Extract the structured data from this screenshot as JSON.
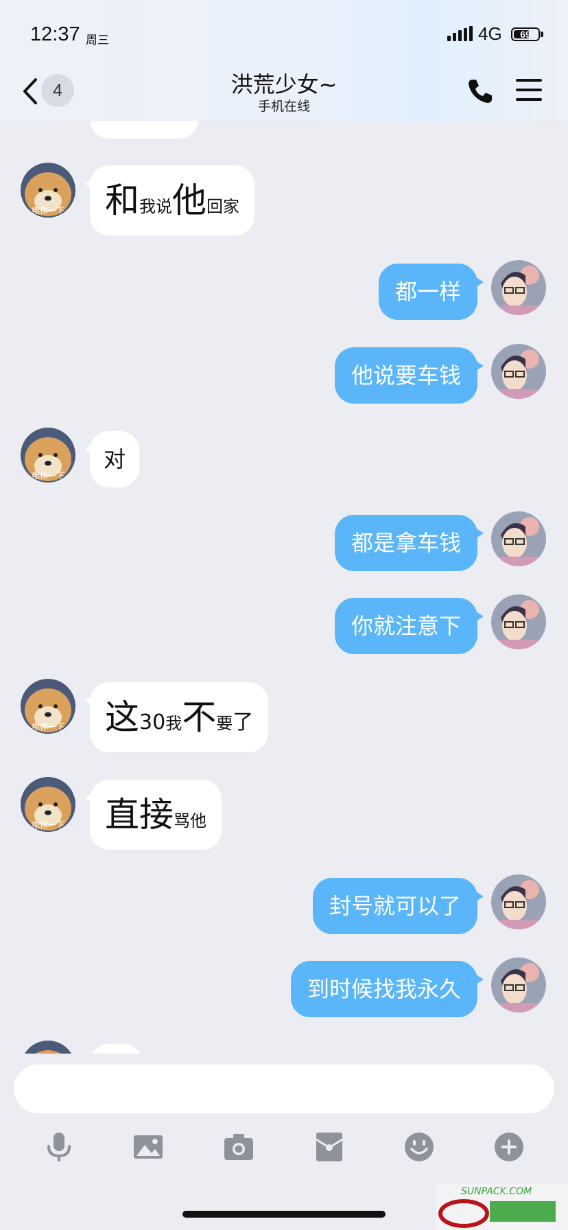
{
  "status_bar": {
    "time": "12:37",
    "day": "周三",
    "network": "4G",
    "battery": "69",
    "battery_level": 0.69
  },
  "header": {
    "back_count": "4",
    "title": "洪荒少女~",
    "subtitle": "手机在线"
  },
  "messages": [
    {
      "side": "left",
      "segments": [
        {
          "t": "和",
          "s": "big"
        },
        {
          "t": "我说",
          "s": "small"
        },
        {
          "t": "他",
          "s": "big"
        },
        {
          "t": "回家",
          "s": "small"
        }
      ]
    },
    {
      "side": "right",
      "text": "都一样"
    },
    {
      "side": "right",
      "text": "他说要车钱"
    },
    {
      "side": "left",
      "text": "对"
    },
    {
      "side": "right",
      "text": "都是拿车钱"
    },
    {
      "side": "right",
      "text": "你就注意下"
    },
    {
      "side": "left",
      "segments": [
        {
          "t": "这",
          "s": "big"
        },
        {
          "t": "30",
          "s": "mid"
        },
        {
          "t": "我",
          "s": "small"
        },
        {
          "t": "不",
          "s": "big"
        },
        {
          "t": "要",
          "s": "small"
        },
        {
          "t": "了",
          "s": "mid"
        }
      ]
    },
    {
      "side": "left",
      "segments": [
        {
          "t": "直接",
          "s": "big"
        },
        {
          "t": "骂他",
          "s": "small"
        }
      ]
    },
    {
      "side": "right",
      "text": "封号就可以了"
    },
    {
      "side": "right",
      "text": "到时候找我永久"
    }
  ],
  "avatar_left_caption": "电你一下",
  "toolbar": [
    "microphone-icon",
    "image-icon",
    "camera-icon",
    "red-packet-icon",
    "emoji-icon",
    "plus-icon"
  ],
  "watermark": "SUNPACK.COM",
  "colors": {
    "bubble_right": "#5ab6f8",
    "bubble_left": "#ffffff",
    "background": "#ececf3",
    "toolbar_icon": "#8e929b"
  }
}
